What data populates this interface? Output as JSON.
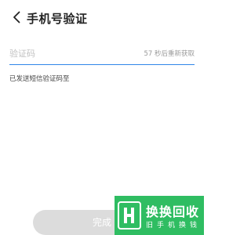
{
  "header": {
    "back_icon": "chevron-left-icon",
    "title": "手机号验证"
  },
  "form": {
    "code_placeholder": "验证码",
    "code_value": "",
    "resend_text": "57 秒后重新获取",
    "hint_text": "已发送短信验证码至"
  },
  "footer": {
    "done_label": "完成"
  },
  "watermark": {
    "title": "换换回收",
    "subtitle": "旧手机换钱",
    "color": "#2fbd62"
  },
  "colors": {
    "accent": "#2f86e8",
    "button_disabled": "#dcdcdc"
  }
}
